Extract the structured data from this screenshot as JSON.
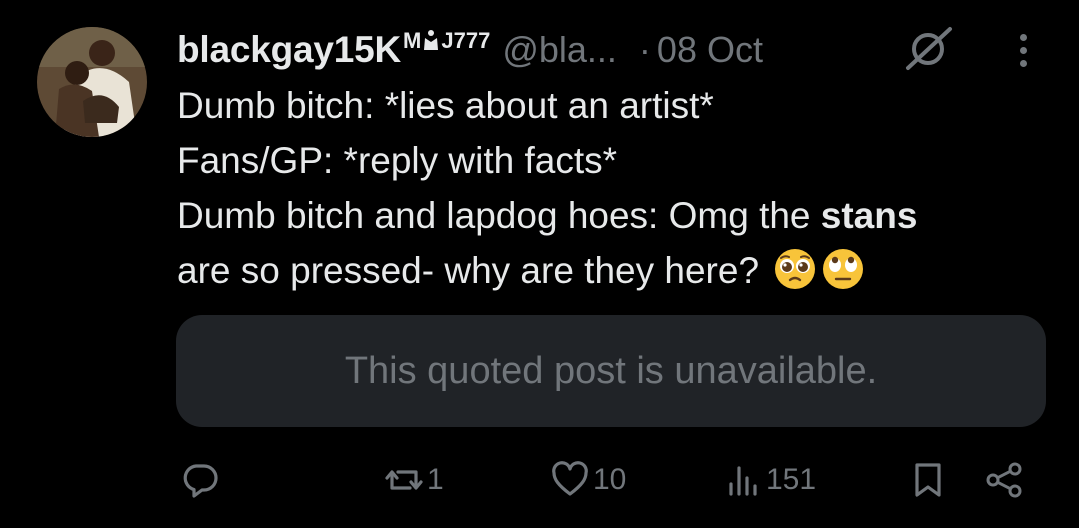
{
  "post": {
    "author": {
      "display_name": "blackgay15K",
      "badge_prefix": "M",
      "badge_suffix": "J777",
      "handle": "@bla...",
      "avatar_icon": "profile-photo"
    },
    "separator": "·",
    "date": "08 Oct",
    "text_lines": [
      "Dumb bitch: *lies about an artist*",
      "Fans/GP: *reply with facts*",
      "Dumb bitch and lapdog hoes: Omg the ",
      "stans",
      "are so pressed- why are they here?"
    ],
    "emojis": [
      "pleading-face",
      "eye-roll-face"
    ],
    "quote": {
      "text": "This quoted post is unavailable."
    },
    "actions": {
      "reply": {
        "icon": "reply-icon",
        "count": ""
      },
      "repost": {
        "icon": "repost-icon",
        "count": "1"
      },
      "like": {
        "icon": "heart-icon",
        "count": "10"
      },
      "views": {
        "icon": "views-icon",
        "count": "151"
      },
      "bookmark": {
        "icon": "bookmark-icon"
      },
      "share": {
        "icon": "share-icon"
      }
    }
  },
  "colors": {
    "background": "#000000",
    "text_primary": "#e7e9ea",
    "text_secondary": "#71767b",
    "quote_bg": "#202327"
  }
}
